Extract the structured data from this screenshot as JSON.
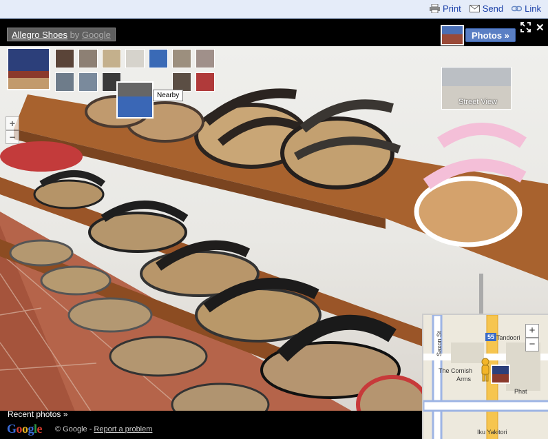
{
  "topbar": {
    "print_label": "Print",
    "send_label": "Send",
    "link_label": "Link"
  },
  "viewer": {
    "title_link": "Allegro Shoes",
    "title_by": "by",
    "title_google": "Google",
    "photos_button": "Photos »",
    "close_glyph": "✕",
    "tooltip": "Nearby",
    "streetview_label": "Street View",
    "zoom_in": "+",
    "zoom_out": "−",
    "recent_photos": "Recent photos »",
    "google_logo": "Google",
    "copyright": "© Google -",
    "report_problem": "Report a problem"
  },
  "map": {
    "street_saxon": "Saxon St",
    "route_number": "55",
    "label_tandoori": "Tandoori",
    "label_cornish": "The Cornish",
    "label_arms": "Arms",
    "label_phat": "Phat",
    "label_iku": "Iku Yakitori",
    "zoom_in": "+",
    "zoom_out": "−"
  },
  "colors": {
    "topbar_bg": "#e5ecf9",
    "link_blue": "#1a3fa8",
    "photos_btn": "#5a7fc4",
    "shelf_wood": "#a8622e"
  }
}
